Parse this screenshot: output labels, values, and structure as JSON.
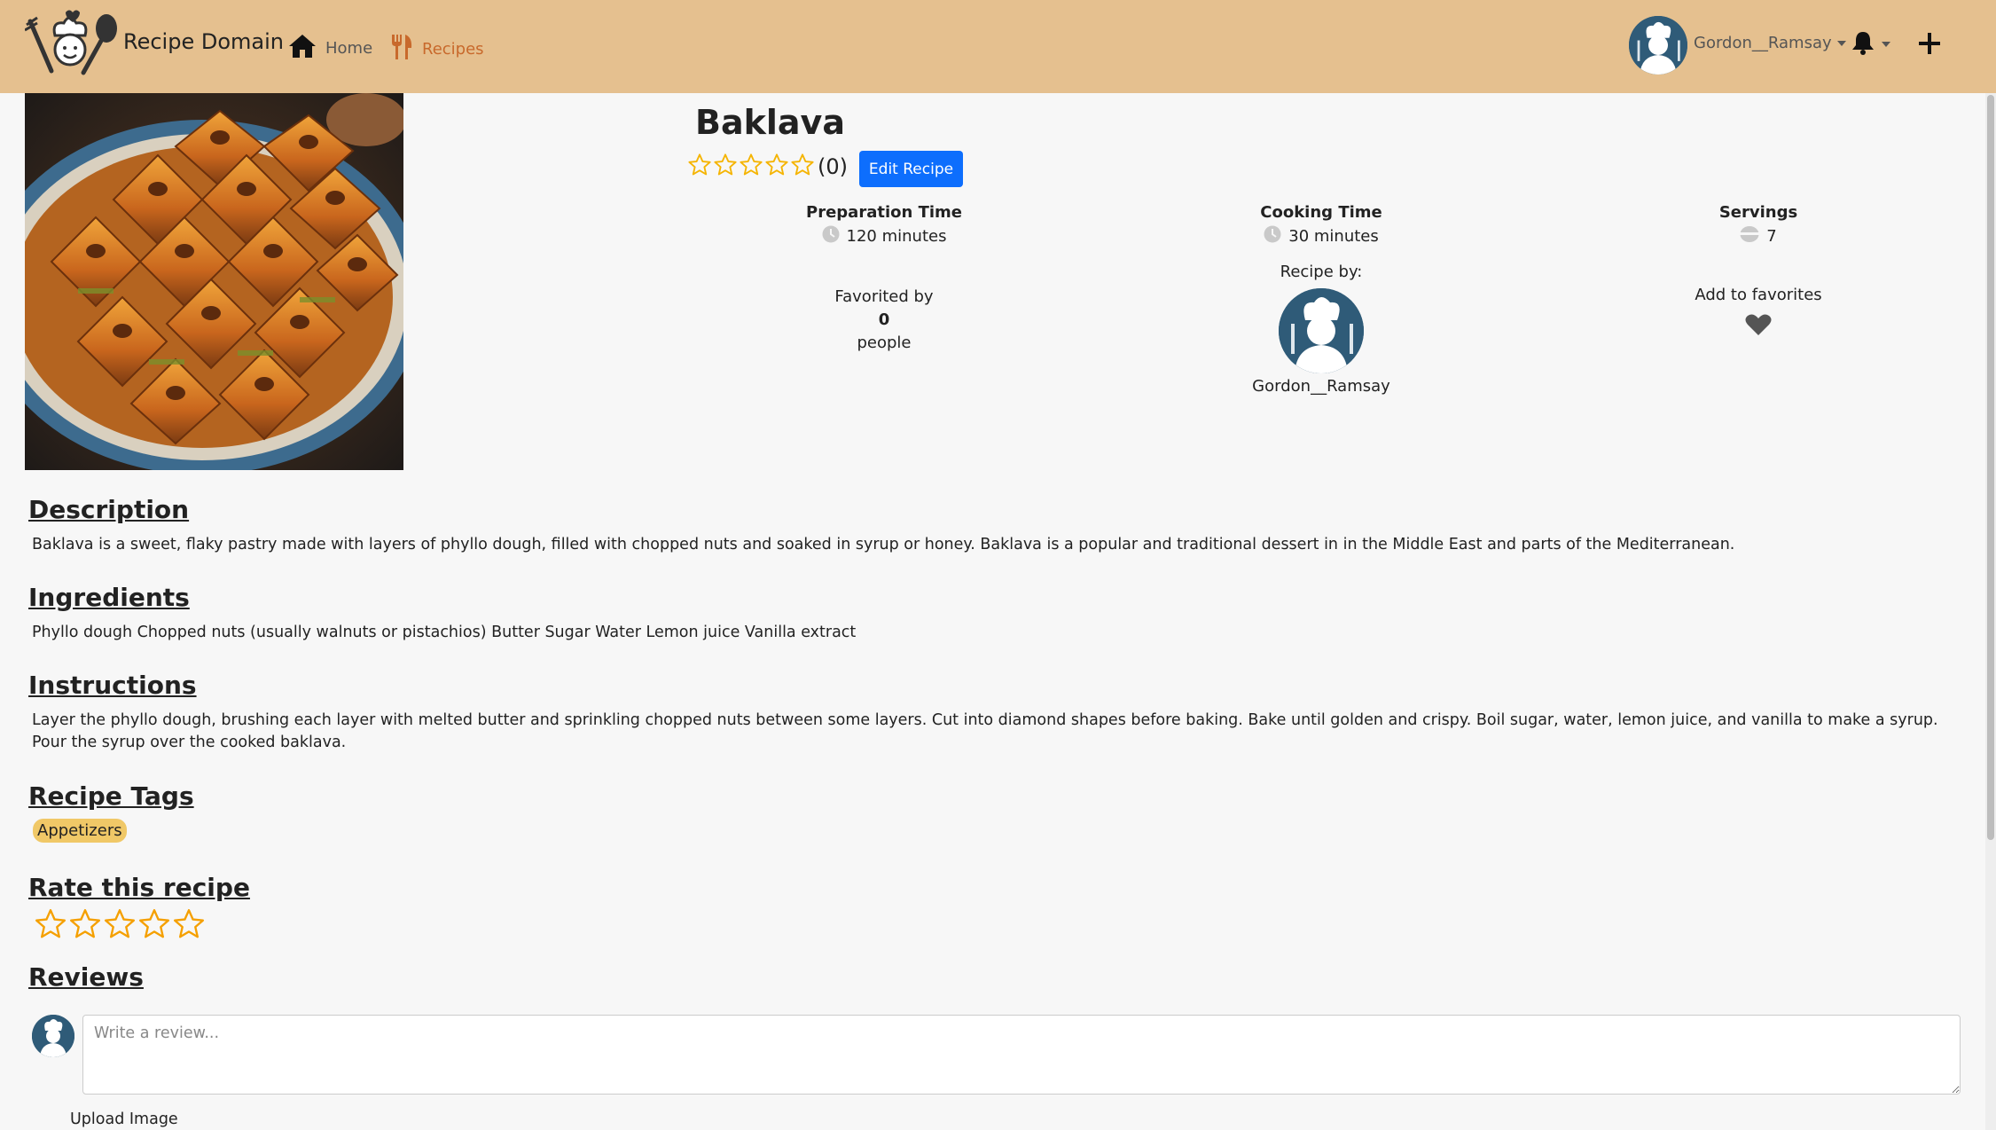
{
  "nav": {
    "brand": "Recipe Domain",
    "home_label": "Home",
    "recipes_label": "Recipes",
    "user_name": "Gordon__Ramsay",
    "colors": {
      "bar": "#e5c08f",
      "active_link": "#c8692c"
    }
  },
  "recipe": {
    "title": "Baklava",
    "rating_count": "(0)",
    "rating_stars": 0,
    "edit_label": "Edit Recipe",
    "prep": {
      "label": "Preparation Time",
      "value": "120 minutes"
    },
    "cook": {
      "label": "Cooking Time",
      "value": "30 minutes"
    },
    "servings": {
      "label": "Servings",
      "value": "7"
    },
    "favorited": {
      "label": "Favorited by",
      "count": "0",
      "suffix": "people"
    },
    "author": {
      "label": "Recipe by:",
      "name": "Gordon__Ramsay"
    },
    "add_favorites_label": "Add to favorites"
  },
  "sections": {
    "description": {
      "heading": "Description",
      "text": "Baklava is a sweet, flaky pastry made with layers of phyllo dough, filled with chopped nuts and soaked in syrup or honey. Baklava is a popular and traditional dessert in in the Middle East and parts of the Mediterranean."
    },
    "ingredients": {
      "heading": "Ingredients",
      "text": "Phyllo dough Chopped nuts (usually walnuts or pistachios) Butter Sugar Water Lemon juice Vanilla extract"
    },
    "instructions": {
      "heading": "Instructions",
      "text": "Layer the phyllo dough, brushing each layer with melted butter and sprinkling chopped nuts between some layers. Cut into diamond shapes before baking. Bake until golden and crispy. Boil sugar, water, lemon juice, and vanilla to make a syrup. Pour the syrup over the cooked baklava."
    },
    "tags": {
      "heading": "Recipe Tags",
      "items": [
        "Appetizers"
      ]
    },
    "rate": {
      "heading": "Rate this recipe"
    },
    "reviews": {
      "heading": "Reviews",
      "placeholder": "Write a review...",
      "upload_label": "Upload Image"
    }
  },
  "icons": {
    "logo": "chef-logo-icon",
    "home": "home-icon",
    "recipes": "utensils-icon",
    "bell": "bell-icon",
    "plus": "plus-icon",
    "clock": "clock-icon",
    "servings": "plate-icon",
    "heart": "heart-icon",
    "star": "star-outline-icon"
  }
}
